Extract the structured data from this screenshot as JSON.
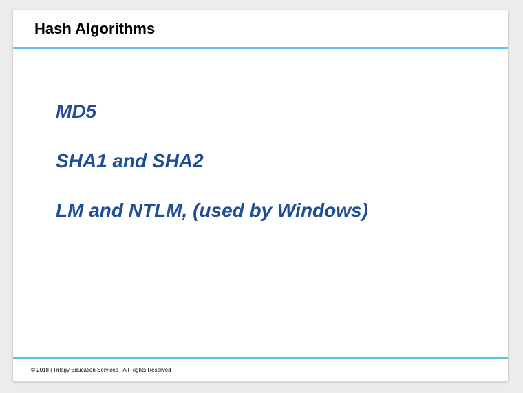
{
  "slide": {
    "title": "Hash Algorithms",
    "bullets": [
      "MD5",
      "SHA1 and SHA2",
      "LM and NTLM, (used by Windows)"
    ],
    "footer": "© 2018 | Trilogy Education Services - All Rights Reserved"
  },
  "colors": {
    "accent_rule": "#5bc3e8",
    "bullet_text": "#1f4e96",
    "title_text": "#000000",
    "page_background": "#ececec",
    "slide_background": "#ffffff"
  }
}
